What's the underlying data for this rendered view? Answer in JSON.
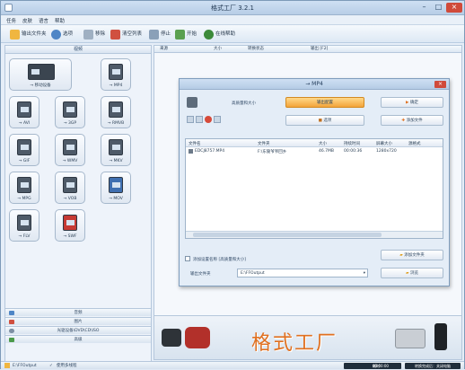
{
  "window": {
    "title": "格式工厂 3.2.1",
    "minimize": "–",
    "maximize": "□",
    "close": "×"
  },
  "menu": [
    "任务",
    "皮肤",
    "语言",
    "帮助"
  ],
  "toolbar": {
    "output_folder": "输出文件夹",
    "options": "选项",
    "remove": "移除",
    "clear_list": "清空列表",
    "stop": "停止",
    "start": "开始",
    "online_help": "在线帮助"
  },
  "left_panel": {
    "header": "视频",
    "tiles": [
      "→ 移动设备",
      "→ MP4",
      "→ AVI",
      "→ 3GP",
      "→ RMVB",
      "→ GIF",
      "→ WMV",
      "→ MKV",
      "→ MPG",
      "→ VOB",
      "→ MOV",
      "→ FLV",
      "→ SWF"
    ],
    "bottom_sections": [
      "音频",
      "图片",
      "光驱设备\\DVD\\CD\\ISO",
      "高级"
    ]
  },
  "list_header": {
    "source": "来源",
    "size": "大小",
    "status": "转换状态",
    "output": "输出 [F2]"
  },
  "dialog": {
    "title": "→ MP4",
    "quality_label": "高质量和大小",
    "output_settings": "输出配置",
    "ok": "确定",
    "options": "选项",
    "add_file": "添加文件",
    "columns": [
      "文件名",
      "文件夹",
      "大小",
      "持续时间",
      "屏幕大小",
      "源格式"
    ],
    "file_row": {
      "name": "EDCJ8757.MP4",
      "folder": "F:\\东陵爷爷回乡",
      "size": "46.7MB",
      "duration": "00:00:36",
      "resolution": "1280x720",
      "format": ""
    },
    "add_to_setting": "添加设置名称",
    "add_setting_detail": "[高质量和大小]",
    "add_folder": "添加文件夹",
    "output_folder_label": "输出文件夹",
    "output_folder_value": "E:\\FFOutput",
    "browse": "浏览"
  },
  "banner": {
    "brand": "格式工厂"
  },
  "statusbar": {
    "output_path": "E:\\FFOutput",
    "multithread": "使用多线程",
    "elapsed_label": "耗时",
    "elapsed": "00:00:00",
    "after_done": "转换完成后：关闭电脑"
  }
}
